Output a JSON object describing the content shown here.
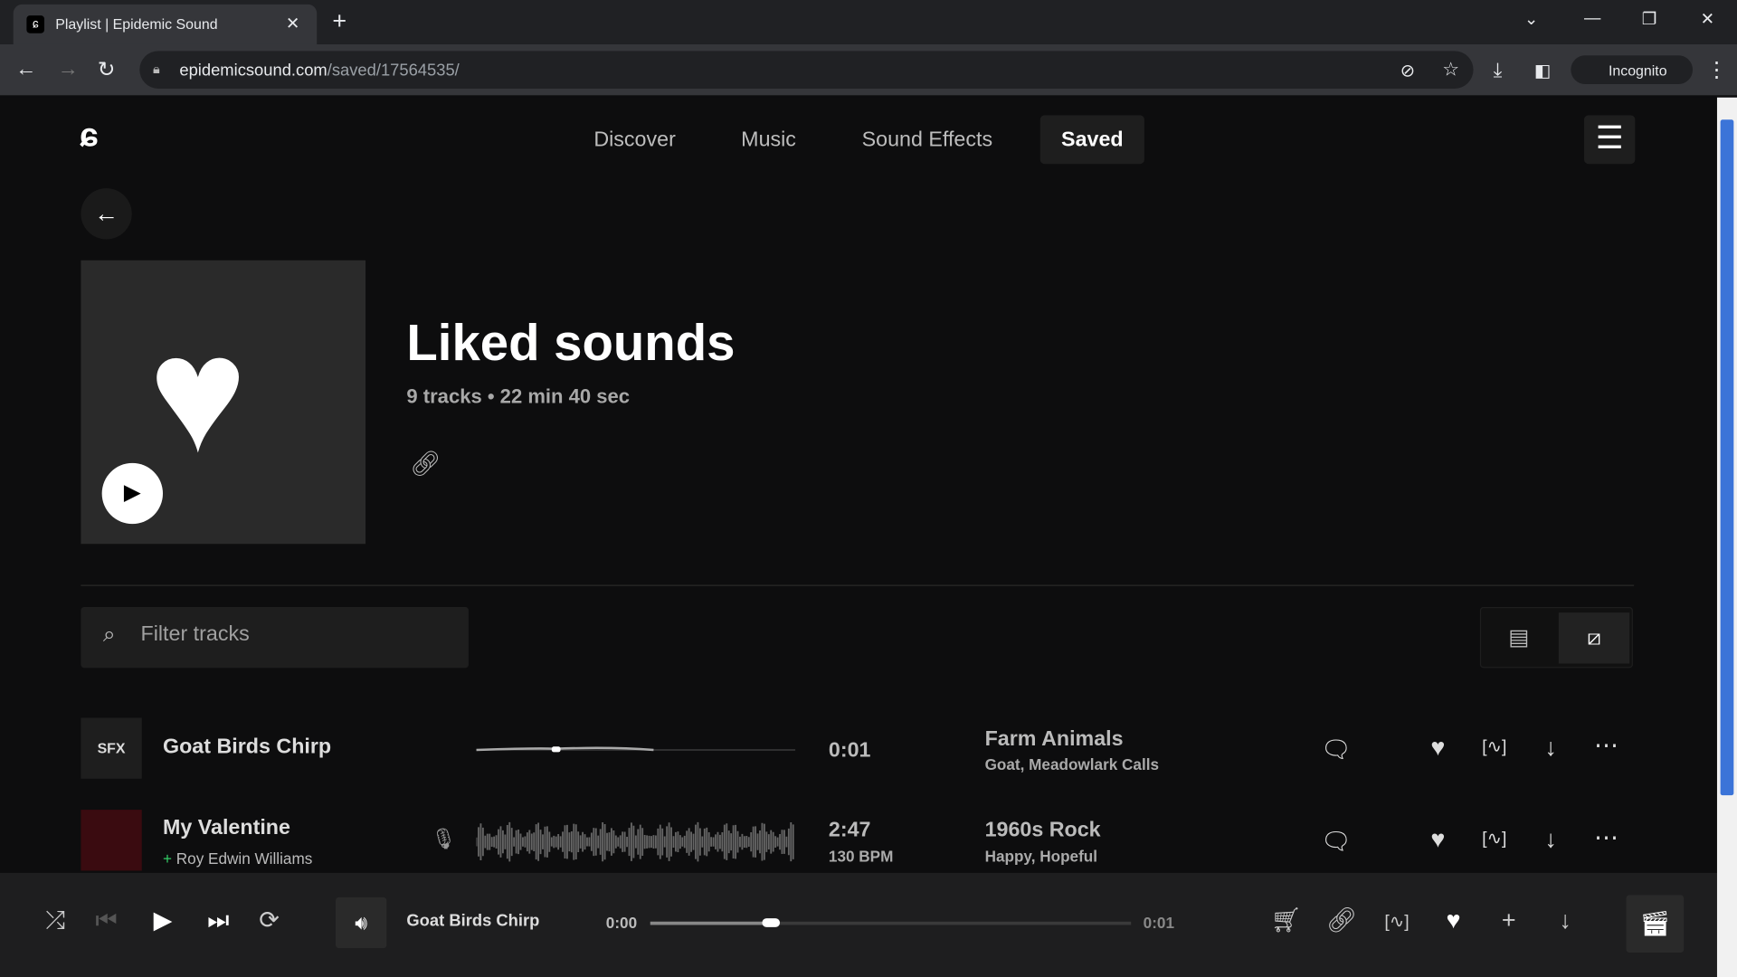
{
  "browser": {
    "tab_title": "Playlist | Epidemic Sound",
    "url_domain": "epidemicsound.com",
    "url_path": "/saved/17564535/",
    "profile": "Incognito"
  },
  "nav": {
    "items": [
      {
        "label": "Discover"
      },
      {
        "label": "Music"
      },
      {
        "label": "Sound Effects"
      },
      {
        "label": "Saved",
        "active": true
      }
    ]
  },
  "playlist": {
    "title": "Liked sounds",
    "meta": "9 tracks • 22 min 40 sec"
  },
  "filter": {
    "placeholder": "Filter tracks"
  },
  "tracks": [
    {
      "thumb": "SFX",
      "title": "Goat Birds Chirp",
      "artist": "",
      "duration": "0:01",
      "bpm": "",
      "category": "Farm Animals",
      "tags": "Goat, Meadowlark Calls",
      "progress": 0.25
    },
    {
      "thumb": "",
      "title": "My Valentine",
      "artist": "Roy Edwin Williams",
      "duration": "2:47",
      "bpm": "130 BPM",
      "category": "1960s Rock",
      "tags": "Happy, Hopeful"
    }
  ],
  "player": {
    "title": "Goat Birds Chirp",
    "current": "0:00",
    "total": "0:01",
    "progress": 0.25
  },
  "colors": {
    "background": "#0d0d0e",
    "player": "#1e1e1f",
    "scroll_thumb": "#3b74d8"
  }
}
